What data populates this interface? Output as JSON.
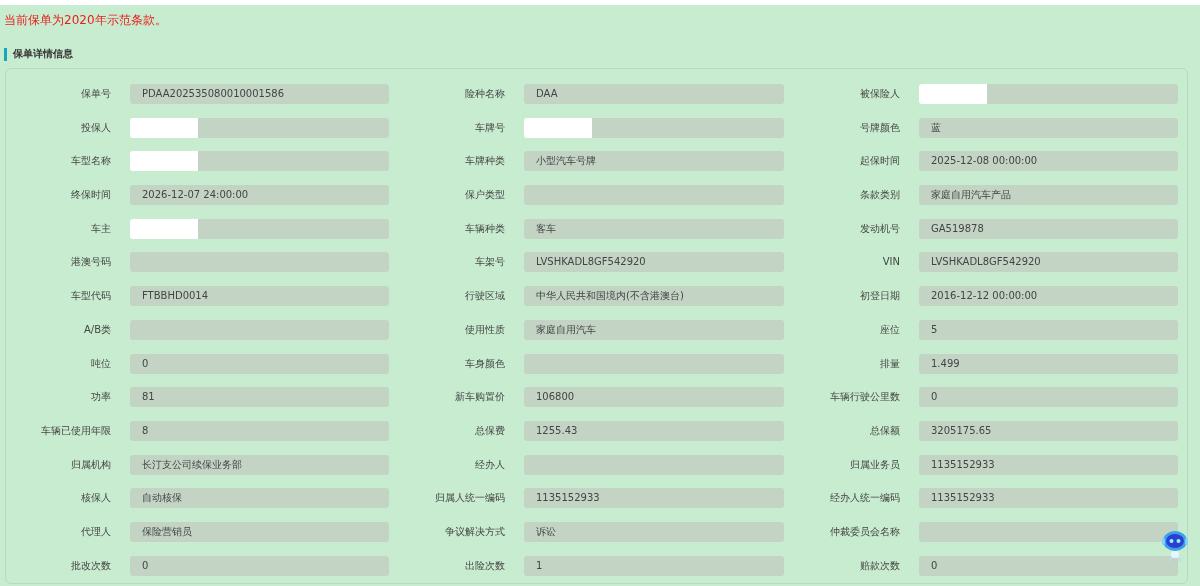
{
  "notice": "当前保单为2020年示范条款。",
  "section_title": "保单详情信息",
  "fields": [
    {
      "label": "保单号",
      "value": "PDAA202535080010001586",
      "redacted": false
    },
    {
      "label": "险种名称",
      "value": "DAA",
      "redacted": false
    },
    {
      "label": "被保险人",
      "redacted": true
    },
    {
      "label": "投保人",
      "redacted": true
    },
    {
      "label": "车牌号",
      "redacted": true
    },
    {
      "label": "号牌颜色",
      "value": "蓝",
      "redacted": false
    },
    {
      "label": "车型名称",
      "redacted": true
    },
    {
      "label": "车牌种类",
      "value": "小型汽车号牌",
      "redacted": false
    },
    {
      "label": "起保时间",
      "value": "2025-12-08 00:00:00",
      "redacted": false
    },
    {
      "label": "终保时间",
      "value": "2026-12-07 24:00:00",
      "redacted": false
    },
    {
      "label": "保户类型",
      "redacted": false
    },
    {
      "label": "条款类别",
      "value": "家庭自用汽车产品",
      "redacted": false
    },
    {
      "label": "车主",
      "redacted": true
    },
    {
      "label": "车辆种类",
      "value": "客车",
      "redacted": false
    },
    {
      "label": "发动机号",
      "value": "GA519878",
      "redacted": false
    },
    {
      "label": "港澳号码",
      "redacted": false
    },
    {
      "label": "车架号",
      "value": "LVSHKADL8GF542920",
      "redacted": false
    },
    {
      "label": "VIN",
      "value": "LVSHKADL8GF542920",
      "redacted": false
    },
    {
      "label": "车型代码",
      "value": "FTBBHD0014",
      "redacted": false
    },
    {
      "label": "行驶区域",
      "value": "中华人民共和国境内(不含港澳台)",
      "redacted": false
    },
    {
      "label": "初登日期",
      "value": "2016-12-12 00:00:00",
      "redacted": false
    },
    {
      "label": "A/B类",
      "redacted": false
    },
    {
      "label": "使用性质",
      "value": "家庭自用汽车",
      "redacted": false
    },
    {
      "label": "座位",
      "value": "5",
      "redacted": false
    },
    {
      "label": "吨位",
      "value": "0",
      "redacted": false
    },
    {
      "label": "车身颜色",
      "redacted": false
    },
    {
      "label": "排量",
      "value": "1.499",
      "redacted": false
    },
    {
      "label": "功率",
      "value": "81",
      "redacted": false
    },
    {
      "label": "新车购置价",
      "value": "106800",
      "redacted": false
    },
    {
      "label": "车辆行驶公里数",
      "value": "0",
      "redacted": false
    },
    {
      "label": "车辆已使用年限",
      "value": "8",
      "redacted": false
    },
    {
      "label": "总保费",
      "value": "1255.43",
      "redacted": false
    },
    {
      "label": "总保额",
      "value": "3205175.65",
      "redacted": false
    },
    {
      "label": "归属机构",
      "value": "长汀支公司续保业务部",
      "redacted": false
    },
    {
      "label": "经办人",
      "redacted": false
    },
    {
      "label": "归属业务员",
      "value": "1135152933",
      "redacted": false
    },
    {
      "label": "核保人",
      "value": "自动核保",
      "redacted": false
    },
    {
      "label": "归属人统一编码",
      "value": "1135152933",
      "redacted": false
    },
    {
      "label": "经办人统一编码",
      "value": "1135152933",
      "redacted": false
    },
    {
      "label": "代理人",
      "value": "保险营销员",
      "redacted": false
    },
    {
      "label": "争议解决方式",
      "value": "诉讼",
      "redacted": false
    },
    {
      "label": "仲裁委员会名称",
      "redacted": false
    },
    {
      "label": "批改次数",
      "value": "0",
      "redacted": false
    },
    {
      "label": "出险次数",
      "value": "1",
      "redacted": false
    },
    {
      "label": "赔款次数",
      "value": "0",
      "redacted": false
    }
  ]
}
